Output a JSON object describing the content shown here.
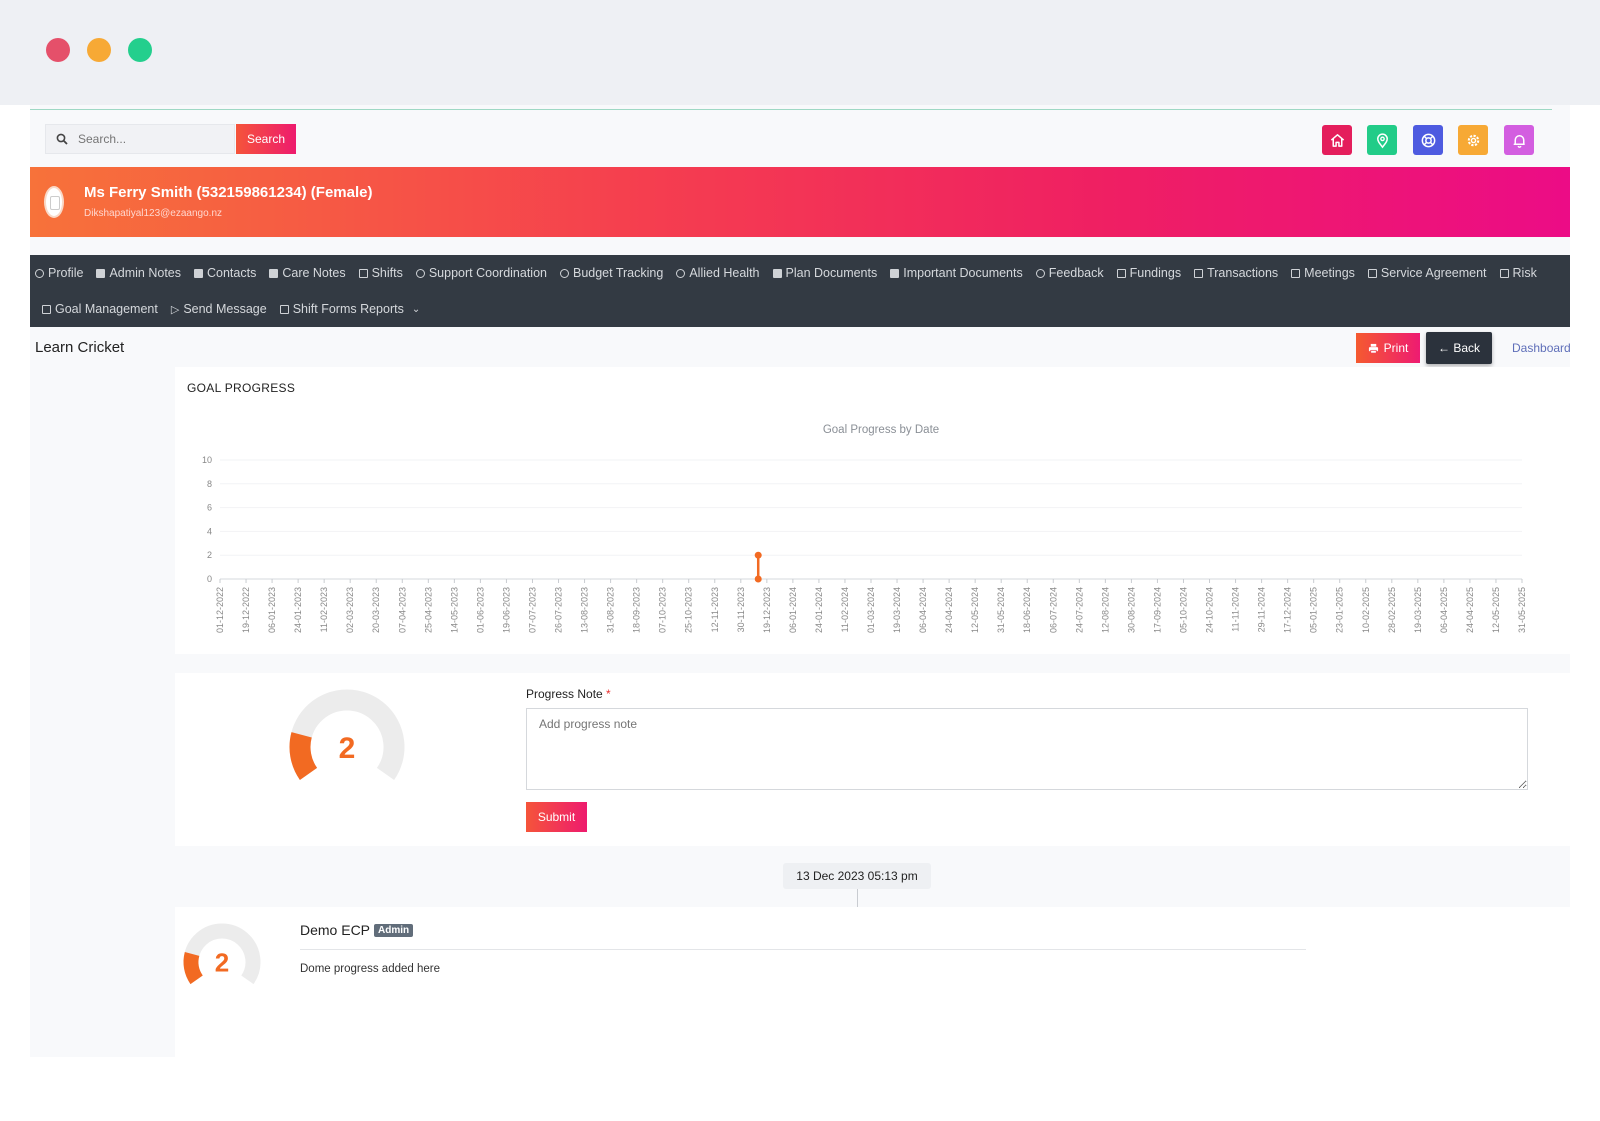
{
  "search": {
    "placeholder": "Search...",
    "button_label": "Search"
  },
  "topbar_icons": [
    {
      "name": "home-icon",
      "color": "#e41e5c"
    },
    {
      "name": "location-pin-icon",
      "color": "#22cc88"
    },
    {
      "name": "support-icon",
      "color": "#4e5be0"
    },
    {
      "name": "gear-icon",
      "color": "#f7a935"
    },
    {
      "name": "bell-icon",
      "color": "#d35ee0"
    }
  ],
  "participant": {
    "name": "Ms Ferry Smith (532159861234) (Female)",
    "email": "Dikshapatiyal123@ezaango.nz"
  },
  "nav": {
    "row1": [
      "Profile",
      "Admin Notes",
      "Contacts",
      "Care Notes",
      "Shifts",
      "Support Coordination",
      "Budget Tracking",
      "Allied Health",
      "Plan Documents",
      "Important Documents",
      "Feedback",
      "Fundings",
      "Transactions",
      "Meetings",
      "Service Agreement",
      "Risk"
    ],
    "row2": [
      "Goal Management",
      "Send Message",
      "Shift Forms Reports"
    ]
  },
  "page": {
    "title": "Learn Cricket",
    "print_label": "Print",
    "back_label": "← Back",
    "dashboard_label": "Dashboard"
  },
  "goal_progress": {
    "section_title": "GOAL PROGRESS"
  },
  "chart_data": {
    "type": "line",
    "title": "Goal Progress by Date",
    "xlabel": "",
    "ylabel": "",
    "ylim": [
      0,
      10
    ],
    "yticks": [
      0,
      2,
      4,
      6,
      8,
      10
    ],
    "categories": [
      "01-12-2022",
      "19-12-2022",
      "06-01-2023",
      "24-01-2023",
      "11-02-2023",
      "02-03-2023",
      "20-03-2023",
      "07-04-2023",
      "25-04-2023",
      "14-05-2023",
      "01-06-2023",
      "19-06-2023",
      "07-07-2023",
      "26-07-2023",
      "13-08-2023",
      "31-08-2023",
      "18-09-2023",
      "07-10-2023",
      "25-10-2023",
      "12-11-2023",
      "30-11-2023",
      "19-12-2023",
      "06-01-2024",
      "24-01-2024",
      "11-02-2024",
      "01-03-2024",
      "19-03-2024",
      "06-04-2024",
      "24-04-2024",
      "12-05-2024",
      "31-05-2024",
      "18-06-2024",
      "06-07-2024",
      "24-07-2024",
      "12-08-2024",
      "30-08-2024",
      "17-09-2024",
      "05-10-2024",
      "24-10-2024",
      "11-11-2024",
      "29-11-2024",
      "17-12-2024",
      "05-01-2025",
      "23-01-2025",
      "10-02-2025",
      "28-02-2025",
      "19-03-2025",
      "06-04-2025",
      "24-04-2025",
      "12-05-2025",
      "31-05-2025"
    ],
    "points": [
      {
        "x": "13-12-2023",
        "y": 2
      },
      {
        "x": "13-12-2023",
        "y": 0
      }
    ],
    "series_color": "#f26a22",
    "grid": true,
    "legend": "none"
  },
  "progress_form": {
    "gauge_value": "2",
    "gauge_fraction": 0.2,
    "label": "Progress Note",
    "required_mark": "*",
    "placeholder": "Add progress note",
    "submit_label": "Submit"
  },
  "timeline": {
    "timestamp": "13 Dec 2023 05:13 pm",
    "entries": [
      {
        "gauge_value": "2",
        "gauge_fraction": 0.2,
        "author": "Demo ECP",
        "role_badge": "Admin",
        "text": "Dome progress added here"
      }
    ]
  }
}
